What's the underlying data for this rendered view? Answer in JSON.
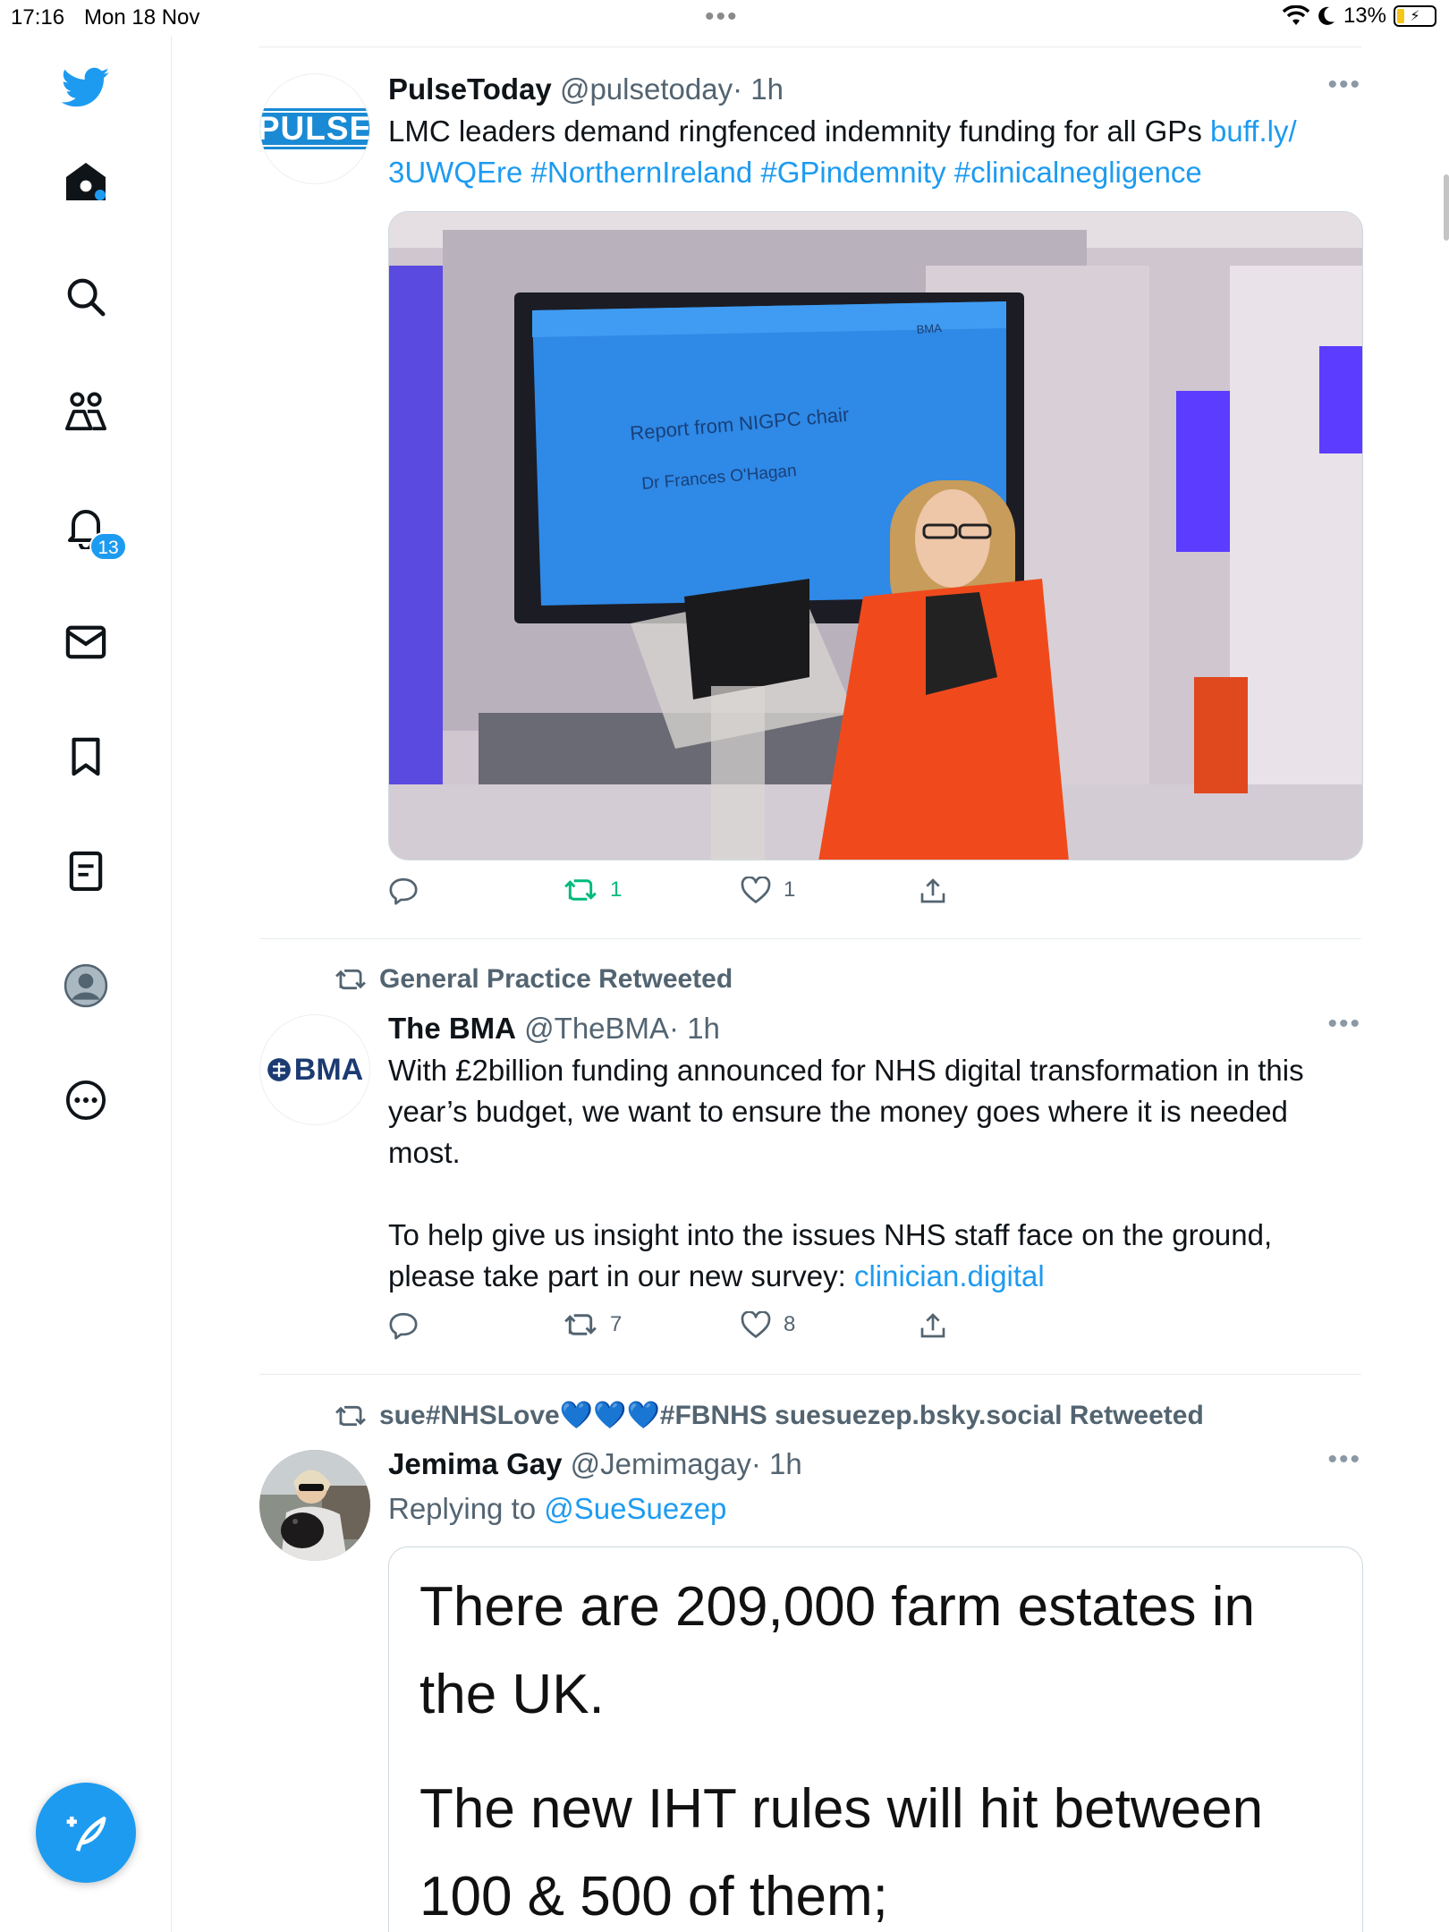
{
  "status_bar": {
    "time": "17:16",
    "date": "Mon 18 Nov",
    "battery": "13%"
  },
  "sidebar": {
    "notifications_badge": "13"
  },
  "tweets": [
    {
      "name": "PulseToday",
      "handle": "@pulsetoday",
      "time": "· 1h",
      "avatar_text": "PULSE",
      "text": "LMC leaders demand ringfenced indemnity funding for all GPs ",
      "link1": "buff.ly/",
      "link2": "3UWQEre #NorthernIreland #GPindemnity #clinicalnegligence",
      "image": {
        "slide_title": "Report from NIGPC chair",
        "slide_name": "Dr Frances O'Hagan",
        "slide_logo": "BMA"
      },
      "retweets": "1",
      "likes": "1"
    },
    {
      "retweeted_by": "General Practice Retweeted",
      "name": "The BMA",
      "handle": "@TheBMA",
      "time": "· 1h",
      "avatar_text": "BMA",
      "text_p1": "With £2billion funding announced for NHS digital transformation in this year’s budget, we want to ensure the money goes where it is needed most.",
      "text_p2": "To help give us insight into the issues NHS staff face on the ground, please take part in our new survey: ",
      "link": "clinician.digital",
      "retweets": "7",
      "likes": "8"
    },
    {
      "retweeted_by": "sue#NHSLove💙💙💙#FBNHS suesuezep.bsky.social Retweeted",
      "name": "Jemima Gay",
      "handle": "@Jemimagay",
      "time": "· 1h",
      "replying_label": "Replying to ",
      "replying_to": "@SueSuezep",
      "image_text_1": "There are 209,000 farm estates in the UK.",
      "image_text_2": "The new IHT rules will hit between 100 & 500 of them;"
    }
  ]
}
